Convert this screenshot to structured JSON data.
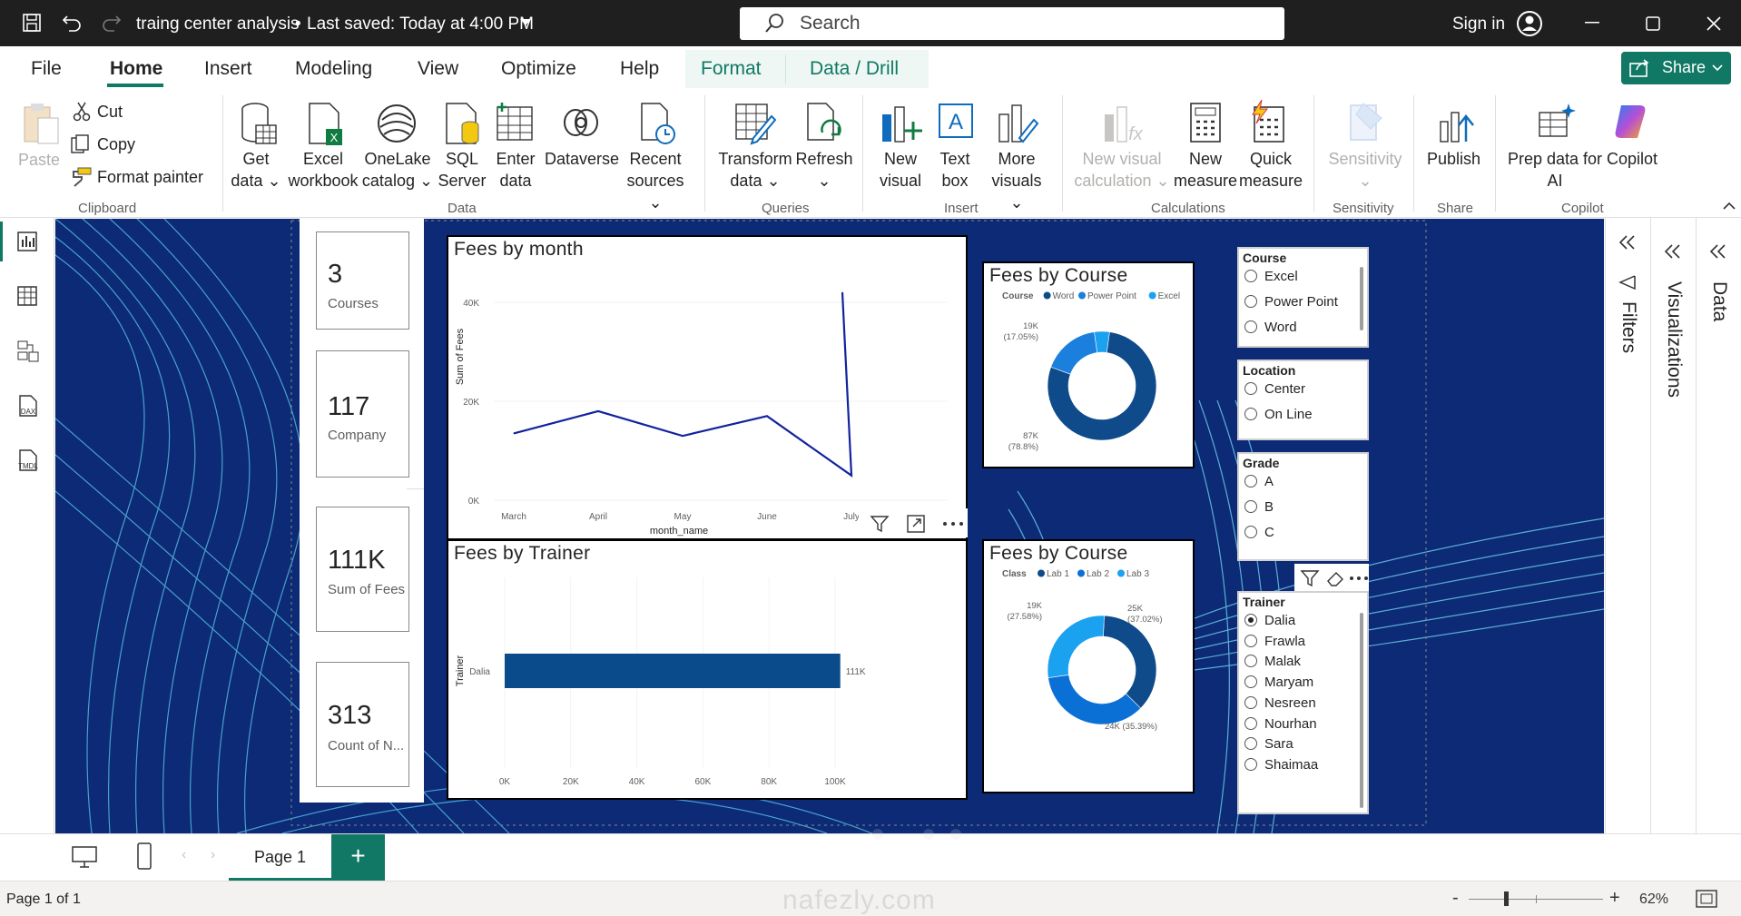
{
  "titlebar": {
    "title": "traing center analysis",
    "saved": "Last saved: Today at 4:00 PM",
    "search_placeholder": "Search",
    "signin": "Sign in"
  },
  "menu": {
    "file": "File",
    "home": "Home",
    "insert": "Insert",
    "modeling": "Modeling",
    "view": "View",
    "optimize": "Optimize",
    "help": "Help",
    "format": "Format",
    "data_drill": "Data / Drill",
    "share": "Share"
  },
  "ribbon": {
    "clipboard": {
      "paste": "Paste",
      "cut": "Cut",
      "copy": "Copy",
      "format_painter": "Format painter",
      "group": "Clipboard"
    },
    "data": {
      "get_data": [
        "Get",
        "data"
      ],
      "excel": [
        "Excel",
        "workbook"
      ],
      "onelake": [
        "OneLake",
        "catalog"
      ],
      "sql": [
        "SQL",
        "Server"
      ],
      "enter": [
        "Enter",
        "data"
      ],
      "dataverse": "Dataverse",
      "recent": [
        "Recent",
        "sources"
      ],
      "group": "Data"
    },
    "queries": {
      "transform": [
        "Transform",
        "data"
      ],
      "refresh": "Refresh",
      "group": "Queries"
    },
    "insert": {
      "new_visual": [
        "New",
        "visual"
      ],
      "text_box": [
        "Text",
        "box"
      ],
      "more_visuals": [
        "More",
        "visuals"
      ],
      "group": "Insert"
    },
    "calculations": {
      "new_visual_calc": [
        "New visual",
        "calculation"
      ],
      "new_measure": [
        "New",
        "measure"
      ],
      "quick_measure": [
        "Quick",
        "measure"
      ],
      "group": "Calculations"
    },
    "sensitivity": {
      "label": "Sensitivity",
      "group": "Sensitivity"
    },
    "share": {
      "publish": "Publish",
      "group": "Share"
    },
    "copilot": {
      "prep": [
        "Prep data for",
        "AI"
      ],
      "copilot": "Copilot",
      "group": "Copilot"
    }
  },
  "cards": [
    {
      "value": "3",
      "label": "Courses"
    },
    {
      "value": "117",
      "label": "Company"
    },
    {
      "value": "111K",
      "label": "Sum of Fees"
    },
    {
      "value": "313",
      "label": "Count of N..."
    }
  ],
  "visual_titles": {
    "month": "Fees by month",
    "trainer": "Fees by Trainer",
    "course1": "Fees by Course",
    "course2": "Fees by Course"
  },
  "chart_data": [
    {
      "type": "line",
      "title": "Fees by month",
      "xlabel": "month_name",
      "ylabel": "Sum of Fees",
      "categories": [
        "March",
        "April",
        "May",
        "June",
        "July",
        ""
      ],
      "values": [
        13500,
        18000,
        13000,
        17000,
        5000,
        42000
      ],
      "yticks": [
        "0K",
        "20K",
        "40K"
      ],
      "ylim": [
        0,
        45000
      ],
      "color": "#12239e"
    },
    {
      "type": "bar",
      "title": "Fees by Trainer",
      "orientation": "horizontal",
      "ylabel": "Trainer",
      "categories": [
        "Dalia"
      ],
      "values": [
        111000
      ],
      "data_labels": [
        "111K"
      ],
      "xticks": [
        "0K",
        "20K",
        "40K",
        "60K",
        "80K",
        "100K"
      ],
      "xlim": [
        0,
        110000
      ],
      "color": "#0a4c8b"
    },
    {
      "type": "pie",
      "title": "Fees by Course",
      "legend_title": "Course",
      "legend": [
        "Word",
        "Power Point",
        "Excel"
      ],
      "values": [
        87,
        19,
        5
      ],
      "labels": [
        "87K\n(78.8%)",
        "19K\n(17.05%)",
        ""
      ],
      "colors": [
        "#0f4a8a",
        "#1b7fdd",
        "#1aa1f0"
      ]
    },
    {
      "type": "pie",
      "title": "Fees by Course",
      "legend_title": "Class",
      "legend": [
        "Lab 1",
        "Lab 2",
        "Lab 3"
      ],
      "values": [
        25,
        24,
        19
      ],
      "labels": [
        "25K\n(37.02%)",
        "24K (35.39%)",
        "19K\n(27.58%)"
      ],
      "colors": [
        "#0f4a8a",
        "#0b70d6",
        "#1aa1f0"
      ]
    }
  ],
  "slicers": {
    "course": {
      "title": "Course",
      "items": [
        "Excel",
        "Power Point",
        "Word"
      ]
    },
    "location": {
      "title": "Location",
      "items": [
        "Center",
        "On Line"
      ]
    },
    "grade": {
      "title": "Grade",
      "items": [
        "A",
        "B",
        "C"
      ]
    },
    "trainer": {
      "title": "Trainer",
      "items": [
        "Dalia",
        "Frawla",
        "Malak",
        "Maryam",
        "Nesreen",
        "Nourhan",
        "Sara",
        "Shaimaa"
      ],
      "selected": "Dalia"
    }
  },
  "panes": {
    "filters": "Filters",
    "visualizations": "Visualizations",
    "data": "Data"
  },
  "pages": {
    "page1": "Page 1"
  },
  "status": {
    "page": "Page 1 of 1",
    "zoom": "62%"
  },
  "watermark": {
    "text": "nafezly.com"
  },
  "colors": {
    "accent": "#117865",
    "canvas": "#0c2a76",
    "titlebar": "#1f1f1f"
  }
}
